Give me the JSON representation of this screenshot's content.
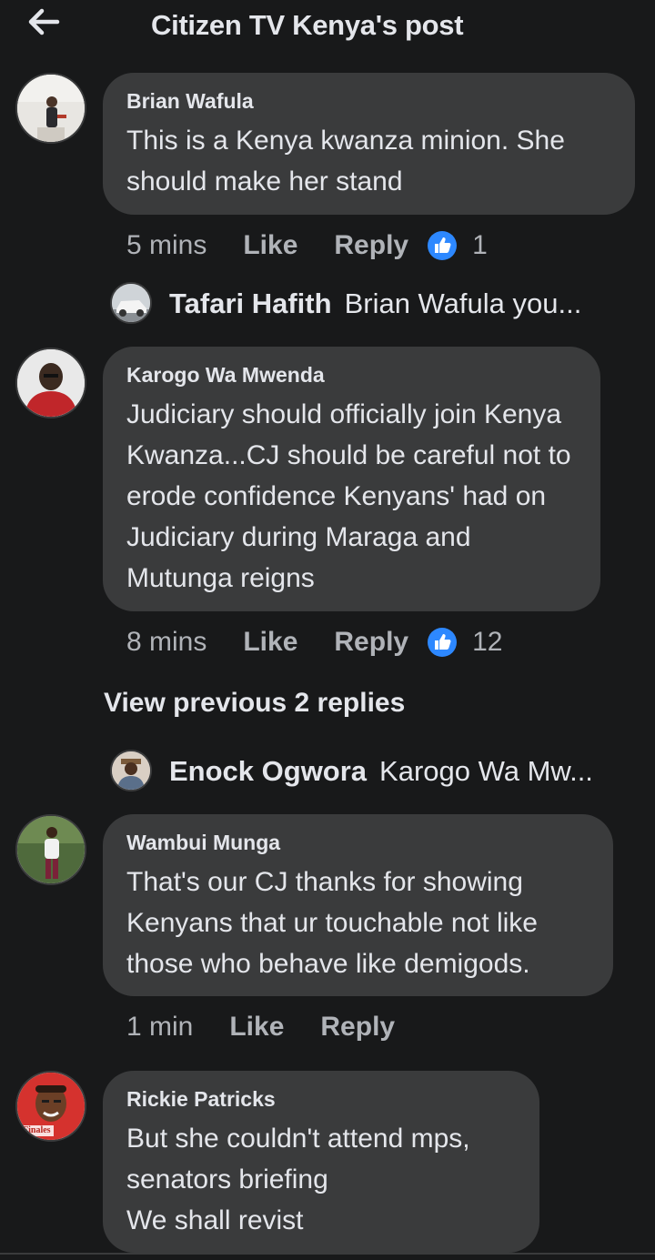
{
  "header": {
    "title": "Citizen TV Kenya's post",
    "back_icon": "back-arrow-icon"
  },
  "colors": {
    "background": "#18191a",
    "bubble": "#3a3b3c",
    "muted": "#b0b3b8",
    "like_blue": "#2d88ff"
  },
  "comments": [
    {
      "author": "Brian Wafula",
      "text": "This is a Kenya kwanza minion. She should make her stand",
      "time": "5 mins",
      "like_label": "Like",
      "reply_label": "Reply",
      "reaction_count": "1",
      "reply_preview": {
        "name": "Tafari Hafith",
        "snippet": "Brian Wafula you..."
      }
    },
    {
      "author": "Karogo Wa Mwenda",
      "text": "Judiciary should officially join Kenya Kwanza...CJ should be careful not to erode confidence Kenyans' had on Judiciary during Maraga and Mutunga reigns",
      "time": "8 mins",
      "like_label": "Like",
      "reply_label": "Reply",
      "reaction_count": "12",
      "view_previous": "View previous 2 replies",
      "reply_preview": {
        "name": "Enock Ogwora",
        "snippet": "Karogo Wa Mw..."
      }
    },
    {
      "author": "Wambui Munga",
      "text": "That's our CJ thanks for showing Kenyans that ur touchable not like those who behave like demigods.",
      "time": "1 min",
      "like_label": "Like",
      "reply_label": "Reply"
    },
    {
      "author": "Rickie Patricks",
      "text": "But she couldn't attend mps, senators briefing\nWe shall revist",
      "avatar_text": "Finales"
    }
  ]
}
